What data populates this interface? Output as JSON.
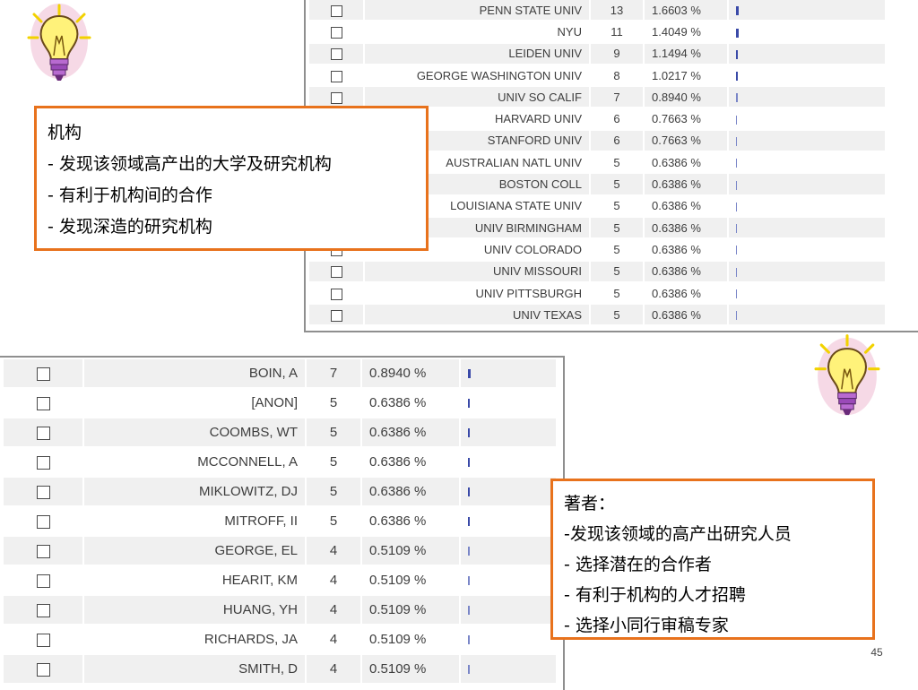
{
  "colors": {
    "accent": "#e8721c",
    "bar": "#3a4aa8",
    "stripe": "#f0f0f0"
  },
  "institutions_table": {
    "rows": [
      {
        "name": "PENN STATE UNIV",
        "count": "13",
        "percent": "1.6603 %",
        "bar_fraction": 1.0
      },
      {
        "name": "NYU",
        "count": "11",
        "percent": "1.4049 %",
        "bar_fraction": 0.85
      },
      {
        "name": "LEIDEN UNIV",
        "count": "9",
        "percent": "1.1494 %",
        "bar_fraction": 0.69
      },
      {
        "name": "GEORGE WASHINGTON UNIV",
        "count": "8",
        "percent": "1.0217 %",
        "bar_fraction": 0.62
      },
      {
        "name": "UNIV SO CALIF",
        "count": "7",
        "percent": "0.8940 %",
        "bar_fraction": 0.54
      },
      {
        "name": "HARVARD UNIV",
        "count": "6",
        "percent": "0.7663 %",
        "bar_fraction": 0.46
      },
      {
        "name": "STANFORD UNIV",
        "count": "6",
        "percent": "0.7663 %",
        "bar_fraction": 0.46
      },
      {
        "name": "AUSTRALIAN NATL UNIV",
        "count": "5",
        "percent": "0.6386 %",
        "bar_fraction": 0.38
      },
      {
        "name": "BOSTON COLL",
        "count": "5",
        "percent": "0.6386 %",
        "bar_fraction": 0.38
      },
      {
        "name": "LOUISIANA STATE UNIV",
        "count": "5",
        "percent": "0.6386 %",
        "bar_fraction": 0.38
      },
      {
        "name": "UNIV BIRMINGHAM",
        "count": "5",
        "percent": "0.6386 %",
        "bar_fraction": 0.38
      },
      {
        "name": "UNIV COLORADO",
        "count": "5",
        "percent": "0.6386 %",
        "bar_fraction": 0.38
      },
      {
        "name": "UNIV MISSOURI",
        "count": "5",
        "percent": "0.6386 %",
        "bar_fraction": 0.38
      },
      {
        "name": "UNIV PITTSBURGH",
        "count": "5",
        "percent": "0.6386 %",
        "bar_fraction": 0.38
      },
      {
        "name": "UNIV TEXAS",
        "count": "5",
        "percent": "0.6386 %",
        "bar_fraction": 0.38
      }
    ]
  },
  "authors_table": {
    "rows": [
      {
        "name": "BOIN, A",
        "count": "7",
        "percent": "0.8940 %",
        "bar_fraction": 1.0
      },
      {
        "name": "[ANON]",
        "count": "5",
        "percent": "0.6386 %",
        "bar_fraction": 0.71
      },
      {
        "name": "COOMBS, WT",
        "count": "5",
        "percent": "0.6386 %",
        "bar_fraction": 0.71
      },
      {
        "name": "MCCONNELL, A",
        "count": "5",
        "percent": "0.6386 %",
        "bar_fraction": 0.71
      },
      {
        "name": "MIKLOWITZ, DJ",
        "count": "5",
        "percent": "0.6386 %",
        "bar_fraction": 0.71
      },
      {
        "name": "MITROFF, II",
        "count": "5",
        "percent": "0.6386 %",
        "bar_fraction": 0.71
      },
      {
        "name": "GEORGE, EL",
        "count": "4",
        "percent": "0.5109 %",
        "bar_fraction": 0.57
      },
      {
        "name": "HEARIT, KM",
        "count": "4",
        "percent": "0.5109 %",
        "bar_fraction": 0.57
      },
      {
        "name": "HUANG, YH",
        "count": "4",
        "percent": "0.5109 %",
        "bar_fraction": 0.57
      },
      {
        "name": "RICHARDS, JA",
        "count": "4",
        "percent": "0.5109 %",
        "bar_fraction": 0.57
      },
      {
        "name": "SMITH, D",
        "count": "4",
        "percent": "0.5109 %",
        "bar_fraction": 0.57
      }
    ]
  },
  "callout_institutions": {
    "lines": [
      "机构",
      "- 发现该领域高产出的大学及研究机构",
      "- 有利于机构间的合作",
      "- 发现深造的研究机构"
    ]
  },
  "callout_authors": {
    "lines": [
      "著者：",
      "-发现该领域的高产出研究人员",
      "- 选择潜在的合作者",
      "- 有利于机构的人才招聘",
      "- 选择小同行审稿专家"
    ]
  },
  "icons": {
    "decoration": "lightbulb-icon",
    "checkbox": "checkbox-icon"
  },
  "page_number": "45"
}
